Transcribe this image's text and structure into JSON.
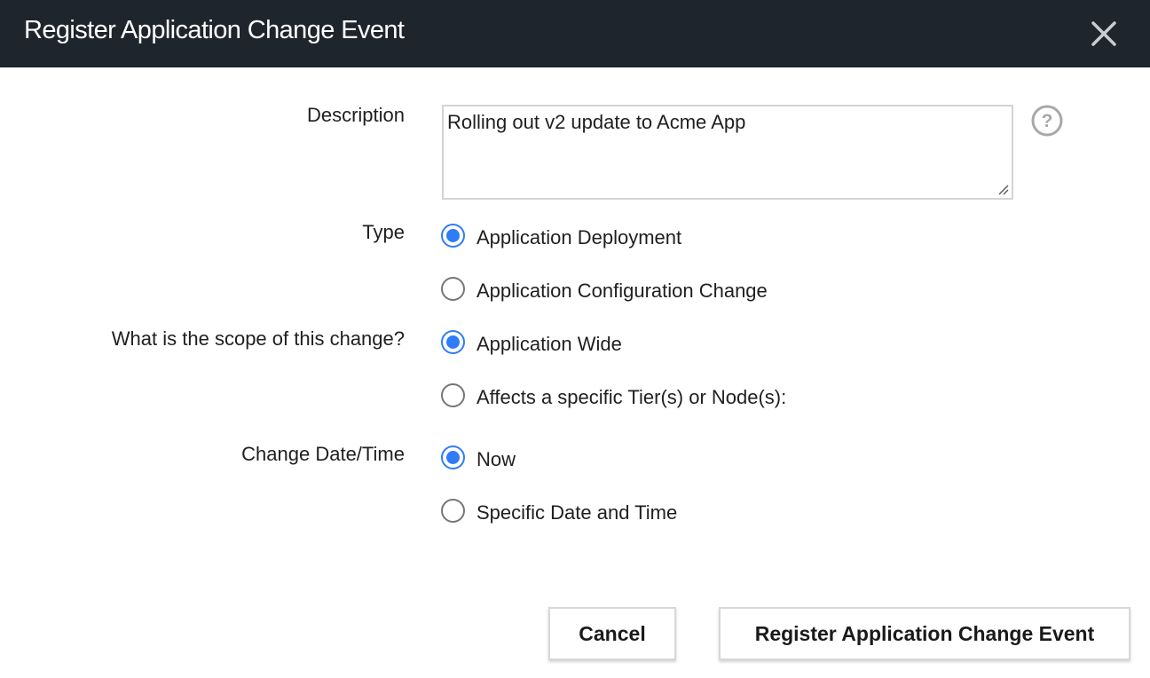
{
  "dialog": {
    "title": "Register Application Change Event"
  },
  "form": {
    "description": {
      "label": "Description",
      "value": "Rolling out v2 update to Acme App"
    },
    "type": {
      "label": "Type",
      "options": [
        {
          "label": "Application Deployment",
          "checked": true
        },
        {
          "label": "Application Configuration Change",
          "checked": false
        }
      ]
    },
    "scope": {
      "label": "What is the scope of this change?",
      "options": [
        {
          "label": "Application Wide",
          "checked": true
        },
        {
          "label": "Affects a specific Tier(s) or Node(s):",
          "checked": false
        }
      ]
    },
    "datetime": {
      "label": "Change Date/Time",
      "options": [
        {
          "label": "Now",
          "checked": true
        },
        {
          "label": "Specific Date and Time",
          "checked": false
        }
      ]
    }
  },
  "buttons": {
    "cancel_label": "Cancel",
    "register_label": "Register Application Change Event"
  },
  "icons": {
    "close": "close-icon",
    "help": "help-icon"
  },
  "colors": {
    "titlebar": "#1f252d",
    "accent": "#2f7cf6"
  }
}
